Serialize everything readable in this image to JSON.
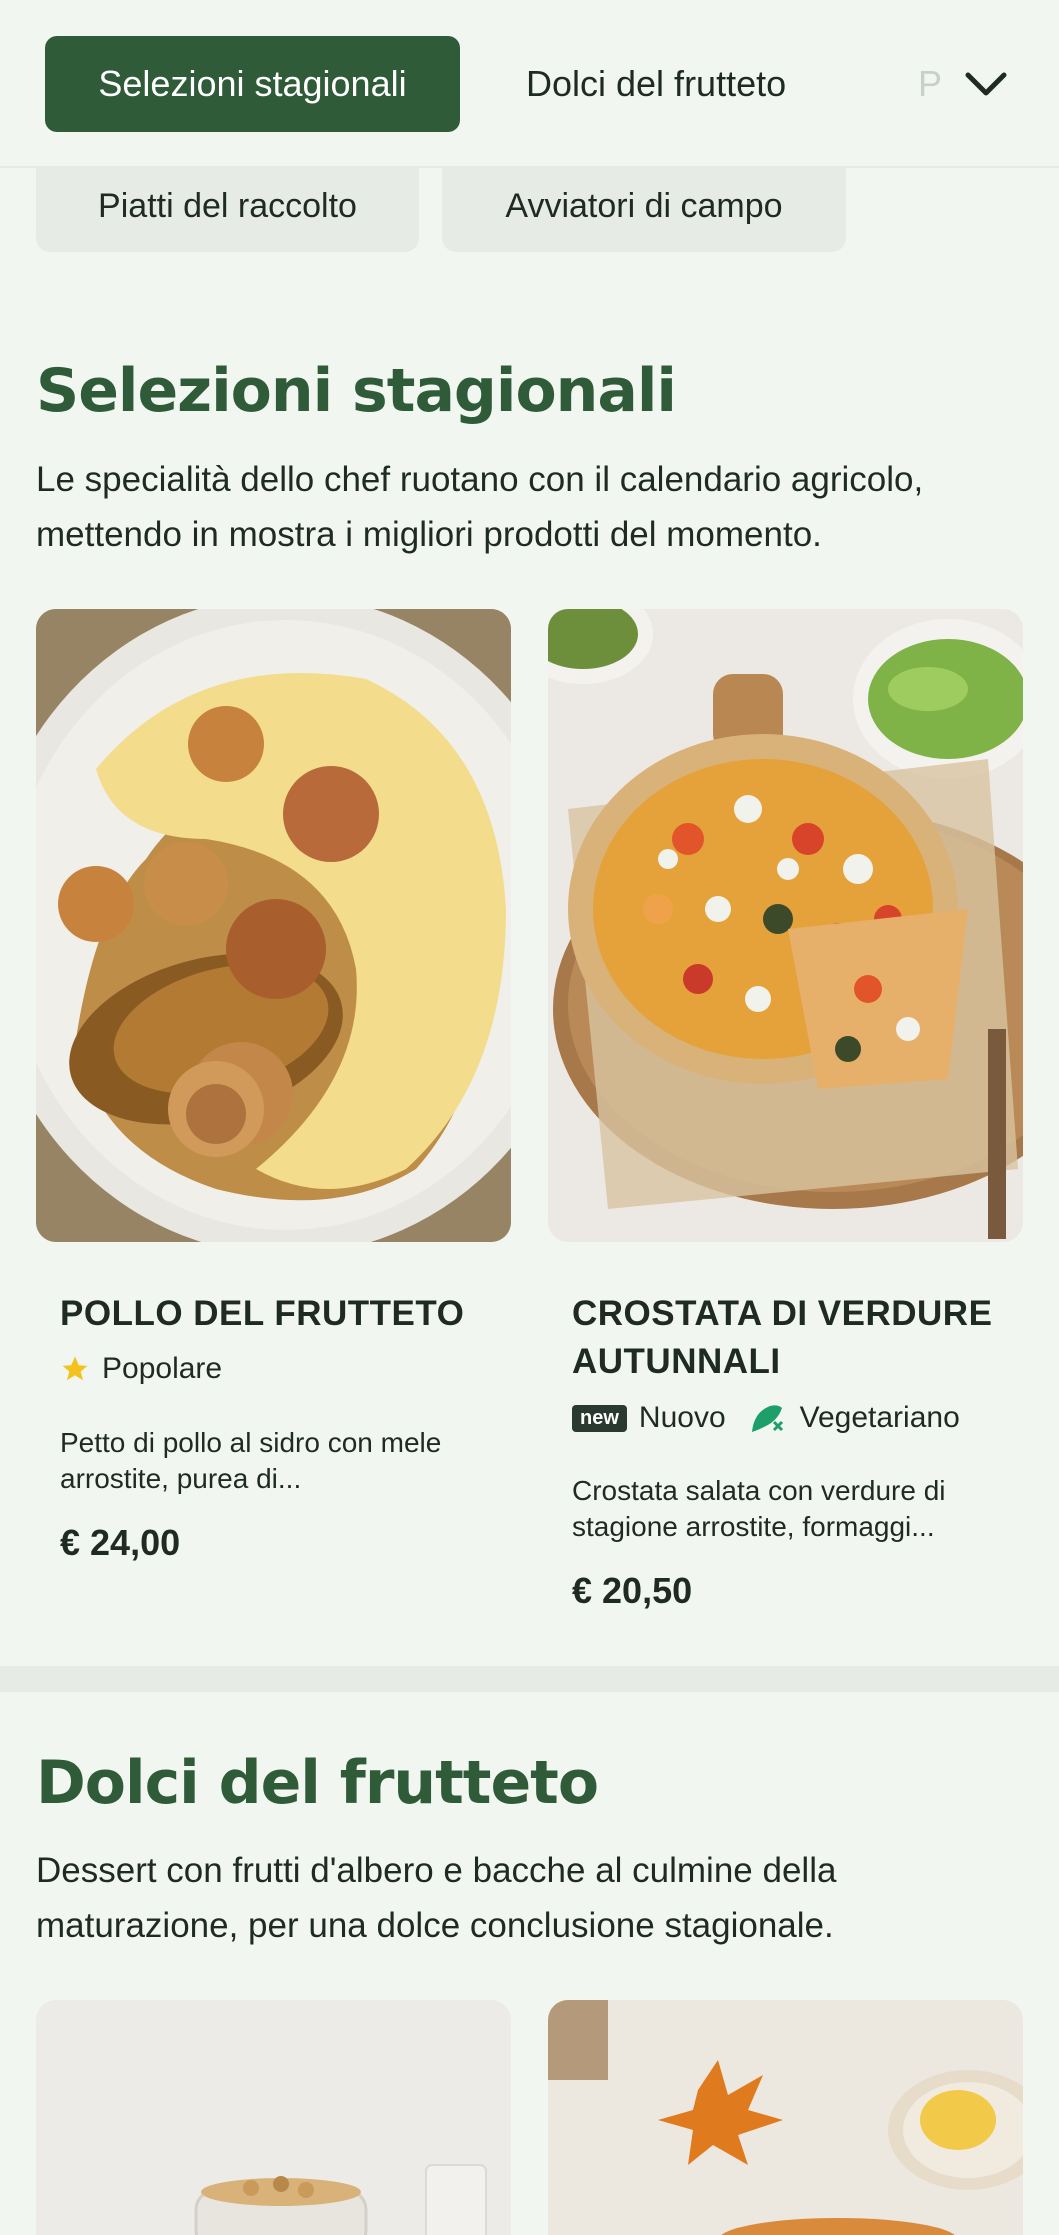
{
  "nav": {
    "tabs": [
      {
        "label": "Selezioni stagionali",
        "active": true
      },
      {
        "label": "Dolci del frutteto",
        "active": false
      },
      {
        "label": "P",
        "active": false
      }
    ],
    "second_row": [
      "Piatti del raccolto",
      "Avviatori di campo"
    ],
    "expand_icon": "chevron-down-icon"
  },
  "sections": [
    {
      "title": "Selezioni stagionali",
      "description": "Le specialità dello chef ruotano con il calendario agricolo, mettendo in mostra i migliori prodotti del momento.",
      "dishes": [
        {
          "name": "POLLO DEL FRUTTETO",
          "tags": [
            {
              "icon": "star-icon",
              "label": "Popolare"
            }
          ],
          "description": "Petto di pollo al sidro con mele arrostite, purea di...",
          "price": "€ 24,00"
        },
        {
          "name": "CROSTATA DI VERDURE AUTUNNALI",
          "tags": [
            {
              "icon": "new-badge",
              "badge": "new",
              "label": "Nuovo"
            },
            {
              "icon": "vegetarian-leaf-icon",
              "label": "Vegetariano"
            }
          ],
          "description": "Crostata salata con verdure di stagione arrostite, formaggi...",
          "price": "€ 20,50"
        }
      ]
    },
    {
      "title": "Dolci del frutteto",
      "description": "Dessert con frutti d'albero e bacche al culmine della maturazione, per una dolce conclusione stagionale."
    }
  ],
  "colors": {
    "background": "#f2f6f1",
    "accent": "#2f5b39",
    "star": "#f4c21c",
    "vegetarian": "#1e9e6a"
  }
}
